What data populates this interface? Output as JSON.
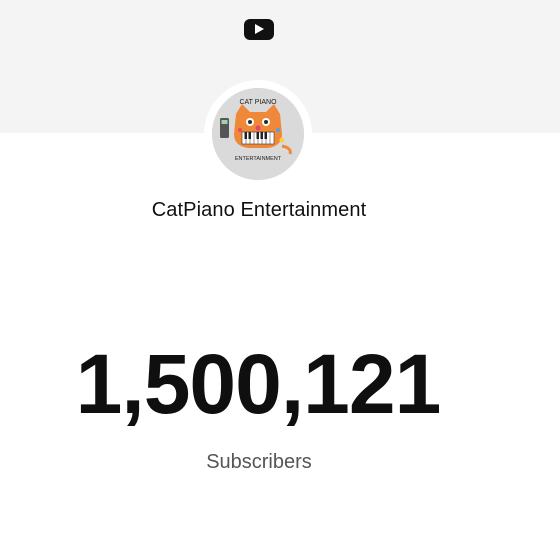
{
  "brand": {
    "icon": "youtube-play-icon"
  },
  "channel": {
    "name": "CatPiano Entertainment",
    "avatar": {
      "icon": "cat-piano-logo",
      "top_text": "CAT PIANO",
      "bottom_text": "ENTERTAINMENT"
    }
  },
  "stats": {
    "subscriber_count": "1,500,121",
    "subscriber_label": "Subscribers"
  },
  "colors": {
    "top_band": "#f4f4f4",
    "background": "#ffffff",
    "count_text": "#0f0f0f",
    "label_text": "#555555",
    "cat_orange": "#f0883a"
  }
}
